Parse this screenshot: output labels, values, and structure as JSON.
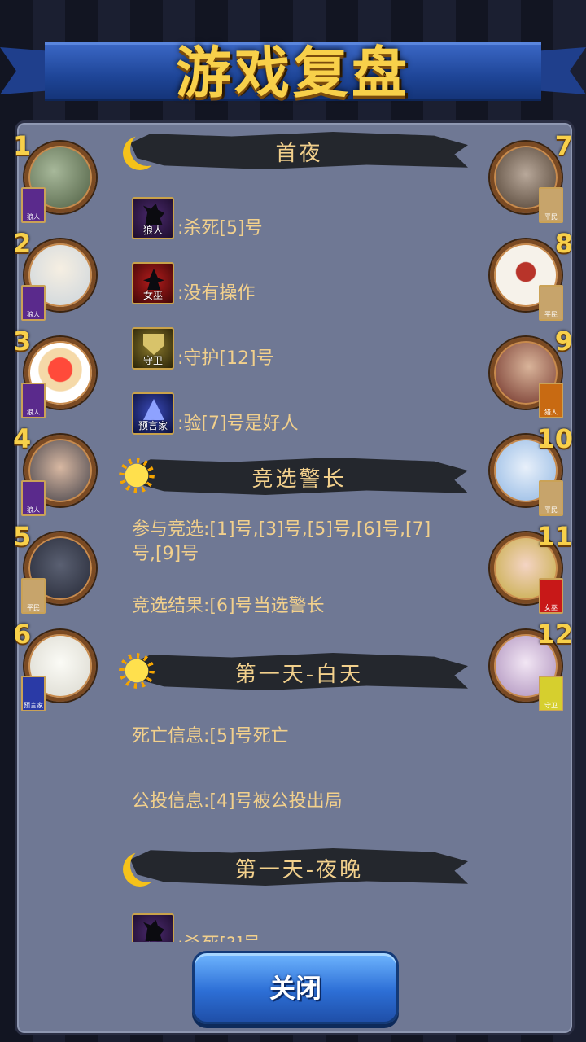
{
  "title": "游戏复盘",
  "close_label": "关闭",
  "sections": {
    "night1": {
      "title": "首夜",
      "actions": [
        {
          "role": "狼人",
          "text": ":杀死[5]号"
        },
        {
          "role": "女巫",
          "text": ":没有操作"
        },
        {
          "role": "守卫",
          "text": ":守护[12]号"
        },
        {
          "role": "预言家",
          "text": ":验[7]号是好人"
        }
      ]
    },
    "sheriff": {
      "title": "竞选警长",
      "participants": "参与竞选:[1]号,[3]号,[5]号,[6]号,[7]号,[9]号",
      "result": "竞选结果:[6]号当选警长"
    },
    "day1": {
      "title": "第一天-白天",
      "death": "死亡信息:[5]号死亡",
      "vote": "公投信息:[4]号被公投出局"
    },
    "night2": {
      "title": "第一天-夜晚",
      "actions": [
        {
          "role": "狼人",
          "text": ":杀死[?]号"
        }
      ]
    }
  },
  "players": [
    {
      "num": "1",
      "role": "狼人"
    },
    {
      "num": "2",
      "role": "狼人"
    },
    {
      "num": "3",
      "role": "狼人"
    },
    {
      "num": "4",
      "role": "狼人"
    },
    {
      "num": "5",
      "role": "平民"
    },
    {
      "num": "6",
      "role": "预言家"
    },
    {
      "num": "7",
      "role": "平民"
    },
    {
      "num": "8",
      "role": "平民"
    },
    {
      "num": "9",
      "role": "猎人"
    },
    {
      "num": "10",
      "role": "平民"
    },
    {
      "num": "11",
      "role": "女巫"
    },
    {
      "num": "12",
      "role": "守卫"
    }
  ],
  "avatar_colors": [
    "#6d8a5a",
    "#e9e4d6",
    "#ffffff",
    "#3a3a44",
    "#3f4454",
    "#f0efe8",
    "#5a4a3a",
    "#f4efe8",
    "#8a4a3a",
    "#cfe0f2",
    "#e6d07a",
    "#d8c8e8"
  ]
}
